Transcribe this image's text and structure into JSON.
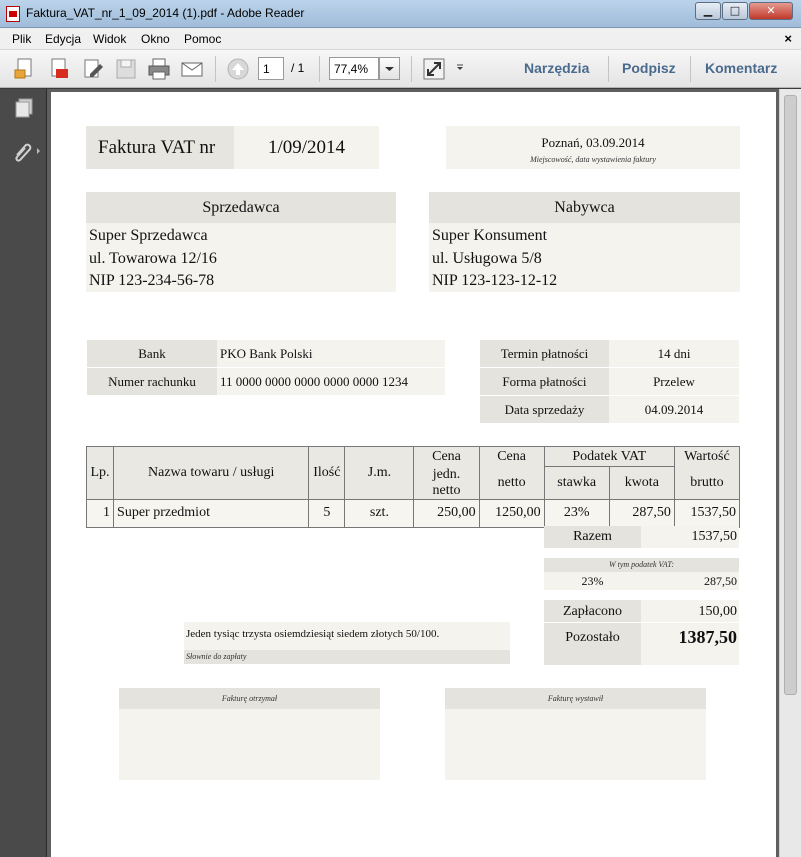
{
  "window": {
    "title": "Faktura_VAT_nr_1_09_2014 (1).pdf - Adobe Reader",
    "controls": {
      "minimize": "▁",
      "maximize": "□",
      "close": "✕"
    }
  },
  "menu": {
    "items": [
      "Plik",
      "Edycja",
      "Widok",
      "Okno",
      "Pomoc"
    ],
    "close_doc": "×"
  },
  "toolbar": {
    "page_current": "1",
    "page_total": "/ 1",
    "zoom": "77,4%",
    "links": {
      "tools": "Narzędzia",
      "sign": "Podpisz",
      "comment": "Komentarz"
    }
  },
  "invoice": {
    "title_label": "Faktura VAT nr",
    "number": "1/09/2014",
    "place_date": "Poznań, 03.09.2014",
    "place_date_caption": "Miejscowość, data wystawienia faktury",
    "seller": {
      "header": "Sprzedawca",
      "lines": [
        "Super Sprzedawca",
        "ul. Towarowa 12/16",
        "NIP 123-234-56-78"
      ]
    },
    "buyer": {
      "header": "Nabywca",
      "lines": [
        "Super Konsument",
        "ul. Usługowa 5/8",
        "NIP 123-123-12-12"
      ]
    },
    "bank": {
      "bank_label": "Bank",
      "bank_value": "PKO Bank Polski",
      "account_label": "Numer rachunku",
      "account_value": "11 0000 0000 0000 0000 0000 1234"
    },
    "payment": {
      "term_label": "Termin płatności",
      "term_value": "14 dni",
      "form_label": "Forma płatności",
      "form_value": "Przelew",
      "sale_date_label": "Data sprzedaży",
      "sale_date_value": "04.09.2014"
    },
    "table": {
      "headers": {
        "lp": "Lp.",
        "name": "Nazwa towaru / usługi",
        "qty": "Ilość",
        "unit": "J.m.",
        "unit_price_1": "Cena",
        "unit_price_2": "jedn. netto",
        "net_1": "Cena",
        "net_2": "netto",
        "vat": "Podatek VAT",
        "vat_rate": "stawka",
        "vat_amount": "kwota",
        "gross_1": "Wartość",
        "gross_2": "brutto"
      },
      "rows": [
        {
          "lp": "1",
          "name": "Super przedmiot",
          "qty": "5",
          "unit": "szt.",
          "unit_price": "250,00",
          "net": "1250,00",
          "vat_rate": "23%",
          "vat_amount": "287,50",
          "gross": "1537,50"
        }
      ]
    },
    "summary": {
      "total_label": "Razem",
      "total_value": "1537,50",
      "vat_caption": "W tym podatek VAT:",
      "vat_rate": "23%",
      "vat_value": "287,50",
      "paid_label": "Zapłacono",
      "paid_value": "150,00",
      "remaining_label": "Pozostało",
      "remaining_value": "1387,50"
    },
    "words": {
      "text": "Jeden tysiąc trzysta osiemdziesiąt siedem złotych 50/100.",
      "caption": "Słownie do zapłaty"
    },
    "signatures": {
      "received": "Fakturę otrzymał",
      "issued": "Fakturę wystawił"
    }
  }
}
